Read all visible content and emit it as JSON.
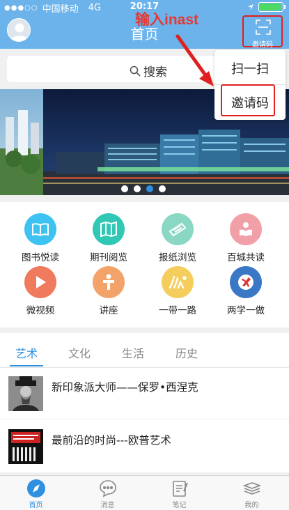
{
  "status_bar": {
    "carrier": "中国移动",
    "network": "4G",
    "time": "20:17"
  },
  "header": {
    "title": "首页",
    "invite_button_label": "邀请码",
    "annotation": "输入inast"
  },
  "search": {
    "label": "搜索"
  },
  "dropdown": {
    "items": [
      {
        "label": "扫一扫"
      },
      {
        "label": "邀请码"
      }
    ]
  },
  "banner": {
    "page_count": 4,
    "active_page": 3
  },
  "grid": {
    "items": [
      {
        "label": "图书悦读",
        "icon": "book-icon",
        "color": "#3ec2f2"
      },
      {
        "label": "期刊阅览",
        "icon": "magazine-icon",
        "color": "#30c8b4"
      },
      {
        "label": "报纸浏览",
        "icon": "newspaper-icon",
        "color": "#8ad8c4"
      },
      {
        "label": "百城共读",
        "icon": "reading-person-icon",
        "color": "#f1a0a8"
      },
      {
        "label": "微视频",
        "icon": "play-icon",
        "color": "#f07a5e"
      },
      {
        "label": "讲座",
        "icon": "lecture-icon",
        "color": "#f3a36a"
      },
      {
        "label": "一带一路",
        "icon": "belt-road-icon",
        "color": "#f4cd5c"
      },
      {
        "label": "两学一做",
        "icon": "party-emblem-icon",
        "color": "#3a78c6"
      }
    ]
  },
  "tabs": {
    "items": [
      {
        "label": "艺术"
      },
      {
        "label": "文化"
      },
      {
        "label": "生活"
      },
      {
        "label": "历史"
      }
    ],
    "active": "艺术"
  },
  "articles": [
    {
      "title": "新印象派大师——保罗•西涅克"
    },
    {
      "title": "最前沿的时尚---欧普艺术"
    }
  ],
  "tabbar": {
    "items": [
      {
        "label": "首页",
        "icon": "compass-icon"
      },
      {
        "label": "消息",
        "icon": "chat-icon"
      },
      {
        "label": "笔记",
        "icon": "note-icon"
      },
      {
        "label": "我的",
        "icon": "books-icon"
      }
    ],
    "active": "首页"
  },
  "colors": {
    "header": "#6bb3ea",
    "accent": "#2f8fe1",
    "highlight": "#e01f1f"
  }
}
